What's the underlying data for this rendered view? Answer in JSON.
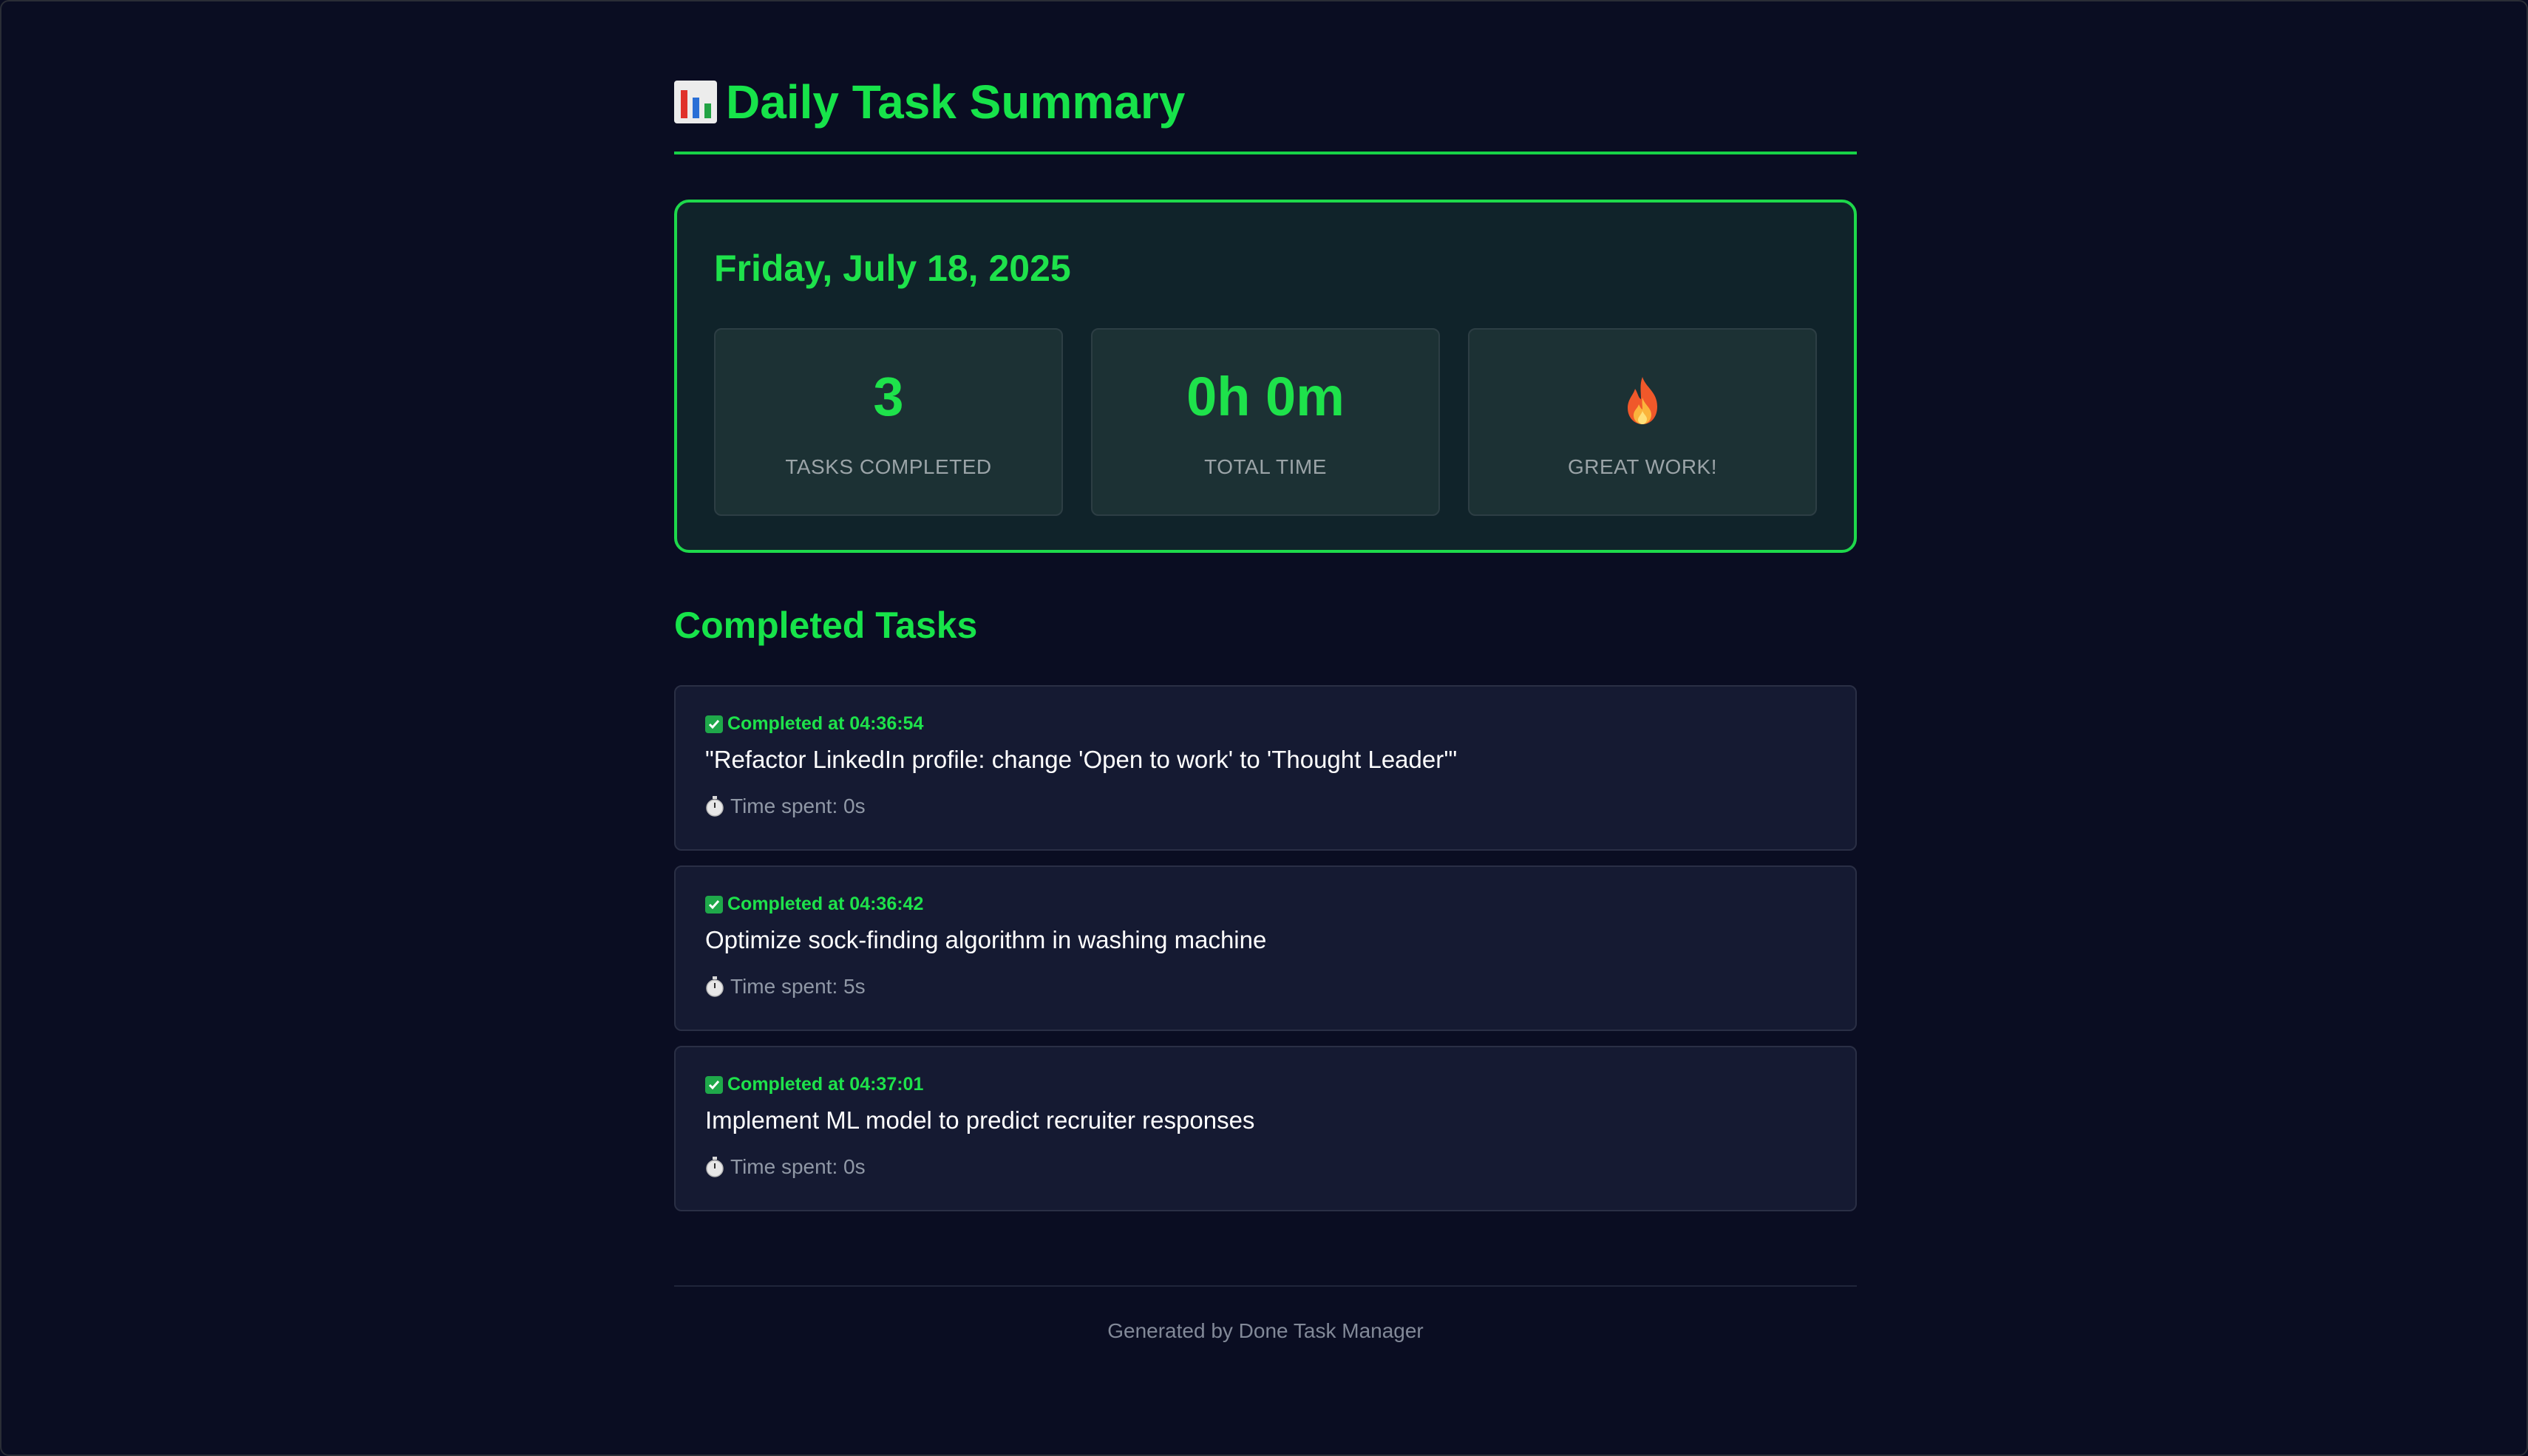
{
  "page": {
    "title": "Daily Task Summary",
    "title_icon": "bar-chart-icon"
  },
  "summary": {
    "date": "Friday, July 18, 2025",
    "stats": [
      {
        "value": "3",
        "label": "TASKS COMPLETED"
      },
      {
        "value": "0h 0m",
        "label": "TOTAL TIME"
      },
      {
        "icon": "fire-icon",
        "label": "GREAT WORK!"
      }
    ]
  },
  "completed": {
    "heading": "Completed Tasks",
    "tasks": [
      {
        "completed_at": "Completed at 04:36:54",
        "title": "\"Refactor LinkedIn profile: change 'Open to work' to 'Thought Leader'\"",
        "time_spent": "Time spent: 0s"
      },
      {
        "completed_at": "Completed at 04:36:42",
        "title": "Optimize sock-finding algorithm in washing machine",
        "time_spent": "Time spent: 5s"
      },
      {
        "completed_at": "Completed at 04:37:01",
        "title": "Implement ML model to predict recruiter responses",
        "time_spent": "Time spent: 0s"
      }
    ]
  },
  "footer": {
    "text": "Generated by Done Task Manager"
  },
  "colors": {
    "background": "#0a0d22",
    "accent": "#1ee24b",
    "card": "#10232a",
    "task_card": "#151a32"
  }
}
